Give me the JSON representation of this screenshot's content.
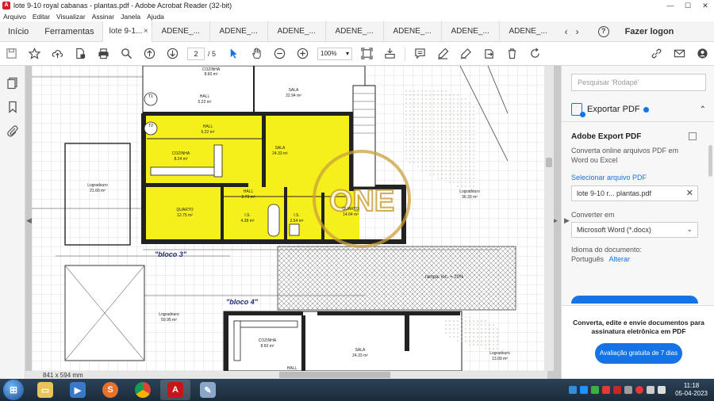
{
  "window": {
    "title": "lote 9-10 royal cabanas - plantas.pdf - Adobe Acrobat Reader (32-bit)",
    "minimize": "—",
    "maximize": "☐",
    "close": "✕"
  },
  "menu": [
    "Arquivo",
    "Editar",
    "Visualizar",
    "Assinar",
    "Janela",
    "Ajuda"
  ],
  "tabs": {
    "home": "Início",
    "tools": "Ferramentas",
    "active": "lote 9-1...",
    "active_close": "×",
    "others": [
      "ADENE_...",
      "ADENE_...",
      "ADENE_...",
      "ADENE_...",
      "ADENE_...",
      "ADENE_...",
      "ADENE_..."
    ],
    "prev": "‹",
    "next": "›",
    "login": "Fazer logon"
  },
  "toolbar": {
    "page_current": "2",
    "page_total": "/ 5",
    "zoom": "100%"
  },
  "document": {
    "page_size": "841 x 594 mm",
    "labels": {
      "bloco3": "\"bloco 3\"",
      "bloco4": "\"bloco 4\"",
      "rampa": "rampa: inc. = 20%",
      "sala_top": "SALA",
      "sala_top_area": "22.94 m²",
      "hall_top": "HALL",
      "hall_top_area": "5.22 m²",
      "hall_yellow": "HALL",
      "hall_yellow_area": "5.22 m²",
      "cozinha": "COZINHA",
      "cozinha_area": "8.24 m²",
      "sala_yellow": "SALA",
      "sala_yellow_area": "24.33 m²",
      "quarto_left": "QUARTO",
      "quarto_left_area": "12.75 m²",
      "hall_mid": "HALL",
      "hall_mid_area": "2.73 m²",
      "is1": "I.S.",
      "is1_area": "4.38 m²",
      "is2": "I.S.",
      "is2_area": "2.54 m²",
      "quarto_right": "QUARTO",
      "quarto_right_area": "14.64 m²",
      "logradouro_left": "Logradouro",
      "logradouro_left_area": "21.60 m²",
      "logradouro_right": "Logradouro",
      "logradouro_right_area": "36.33 m²",
      "logradouro_bottom": "Logradouro",
      "logradouro_bottom_area": "59.95 m²",
      "logradouro_br": "Logradouro",
      "logradouro_br_area": "13.00 m²",
      "cozinha_bottom": "COZINHA",
      "cozinha_bottom_area": "8.60 m²",
      "sala_bottom": "SALA",
      "sala_bottom_area": "24.33 m²",
      "hall_bottom": "HALL",
      "cozinha_top": "COZINHA",
      "cozinha_top_area": "8.60 m²",
      "t1": "T1",
      "t2": "T2",
      "watermark": "ONE"
    }
  },
  "panel": {
    "search_placeholder": "Pesquisar 'Rodapé'",
    "export_title": "Exportar PDF",
    "collapse": "⌃",
    "sub_title": "Adobe Export PDF",
    "description": "Converta online arquivos PDF em Word ou Excel",
    "select_link": "Selecionar arquivo PDF",
    "file_name": "lote 9-10 r... plantas.pdf",
    "file_close": "✕",
    "convert_label": "Converter em",
    "convert_value": "Microsoft Word (*.docx)",
    "convert_chevron": "⌄",
    "lang_label": "Idioma do documento:",
    "lang_value": "Português",
    "lang_change": "Alterar",
    "promo_text": "Converta, edite e envie documentos para assinatura eletrônica em PDF",
    "promo_button": "Avaliação gratuita de 7 dias"
  },
  "taskbar": {
    "time": "11:18",
    "date": "05-04-2023"
  },
  "colors": {
    "accent": "#1473e6",
    "plan_yellow": "#f5ef1c",
    "taskbar": "#1b2b3b"
  }
}
